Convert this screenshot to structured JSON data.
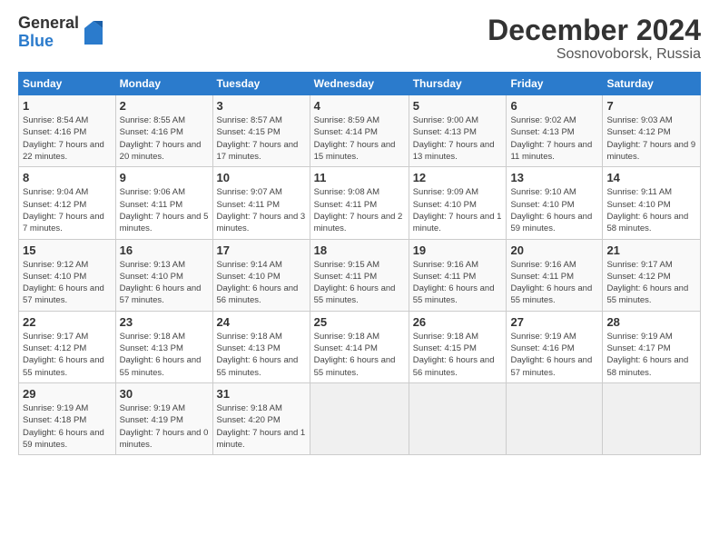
{
  "header": {
    "logo_general": "General",
    "logo_blue": "Blue",
    "title": "December 2024",
    "subtitle": "Sosnovoborsk, Russia"
  },
  "days_of_week": [
    "Sunday",
    "Monday",
    "Tuesday",
    "Wednesday",
    "Thursday",
    "Friday",
    "Saturday"
  ],
  "weeks": [
    [
      {
        "day": "1",
        "sunrise": "8:54 AM",
        "sunset": "4:16 PM",
        "daylight": "7 hours and 22 minutes."
      },
      {
        "day": "2",
        "sunrise": "8:55 AM",
        "sunset": "4:16 PM",
        "daylight": "7 hours and 20 minutes."
      },
      {
        "day": "3",
        "sunrise": "8:57 AM",
        "sunset": "4:15 PM",
        "daylight": "7 hours and 17 minutes."
      },
      {
        "day": "4",
        "sunrise": "8:59 AM",
        "sunset": "4:14 PM",
        "daylight": "7 hours and 15 minutes."
      },
      {
        "day": "5",
        "sunrise": "9:00 AM",
        "sunset": "4:13 PM",
        "daylight": "7 hours and 13 minutes."
      },
      {
        "day": "6",
        "sunrise": "9:02 AM",
        "sunset": "4:13 PM",
        "daylight": "7 hours and 11 minutes."
      },
      {
        "day": "7",
        "sunrise": "9:03 AM",
        "sunset": "4:12 PM",
        "daylight": "7 hours and 9 minutes."
      }
    ],
    [
      {
        "day": "8",
        "sunrise": "9:04 AM",
        "sunset": "4:12 PM",
        "daylight": "7 hours and 7 minutes."
      },
      {
        "day": "9",
        "sunrise": "9:06 AM",
        "sunset": "4:11 PM",
        "daylight": "7 hours and 5 minutes."
      },
      {
        "day": "10",
        "sunrise": "9:07 AM",
        "sunset": "4:11 PM",
        "daylight": "7 hours and 3 minutes."
      },
      {
        "day": "11",
        "sunrise": "9:08 AM",
        "sunset": "4:11 PM",
        "daylight": "7 hours and 2 minutes."
      },
      {
        "day": "12",
        "sunrise": "9:09 AM",
        "sunset": "4:10 PM",
        "daylight": "7 hours and 1 minute."
      },
      {
        "day": "13",
        "sunrise": "9:10 AM",
        "sunset": "4:10 PM",
        "daylight": "6 hours and 59 minutes."
      },
      {
        "day": "14",
        "sunrise": "9:11 AM",
        "sunset": "4:10 PM",
        "daylight": "6 hours and 58 minutes."
      }
    ],
    [
      {
        "day": "15",
        "sunrise": "9:12 AM",
        "sunset": "4:10 PM",
        "daylight": "6 hours and 57 minutes."
      },
      {
        "day": "16",
        "sunrise": "9:13 AM",
        "sunset": "4:10 PM",
        "daylight": "6 hours and 57 minutes."
      },
      {
        "day": "17",
        "sunrise": "9:14 AM",
        "sunset": "4:10 PM",
        "daylight": "6 hours and 56 minutes."
      },
      {
        "day": "18",
        "sunrise": "9:15 AM",
        "sunset": "4:11 PM",
        "daylight": "6 hours and 55 minutes."
      },
      {
        "day": "19",
        "sunrise": "9:16 AM",
        "sunset": "4:11 PM",
        "daylight": "6 hours and 55 minutes."
      },
      {
        "day": "20",
        "sunrise": "9:16 AM",
        "sunset": "4:11 PM",
        "daylight": "6 hours and 55 minutes."
      },
      {
        "day": "21",
        "sunrise": "9:17 AM",
        "sunset": "4:12 PM",
        "daylight": "6 hours and 55 minutes."
      }
    ],
    [
      {
        "day": "22",
        "sunrise": "9:17 AM",
        "sunset": "4:12 PM",
        "daylight": "6 hours and 55 minutes."
      },
      {
        "day": "23",
        "sunrise": "9:18 AM",
        "sunset": "4:13 PM",
        "daylight": "6 hours and 55 minutes."
      },
      {
        "day": "24",
        "sunrise": "9:18 AM",
        "sunset": "4:13 PM",
        "daylight": "6 hours and 55 minutes."
      },
      {
        "day": "25",
        "sunrise": "9:18 AM",
        "sunset": "4:14 PM",
        "daylight": "6 hours and 55 minutes."
      },
      {
        "day": "26",
        "sunrise": "9:18 AM",
        "sunset": "4:15 PM",
        "daylight": "6 hours and 56 minutes."
      },
      {
        "day": "27",
        "sunrise": "9:19 AM",
        "sunset": "4:16 PM",
        "daylight": "6 hours and 57 minutes."
      },
      {
        "day": "28",
        "sunrise": "9:19 AM",
        "sunset": "4:17 PM",
        "daylight": "6 hours and 58 minutes."
      }
    ],
    [
      {
        "day": "29",
        "sunrise": "9:19 AM",
        "sunset": "4:18 PM",
        "daylight": "6 hours and 59 minutes."
      },
      {
        "day": "30",
        "sunrise": "9:19 AM",
        "sunset": "4:19 PM",
        "daylight": "7 hours and 0 minutes."
      },
      {
        "day": "31",
        "sunrise": "9:18 AM",
        "sunset": "4:20 PM",
        "daylight": "7 hours and 1 minute."
      },
      null,
      null,
      null,
      null
    ]
  ]
}
